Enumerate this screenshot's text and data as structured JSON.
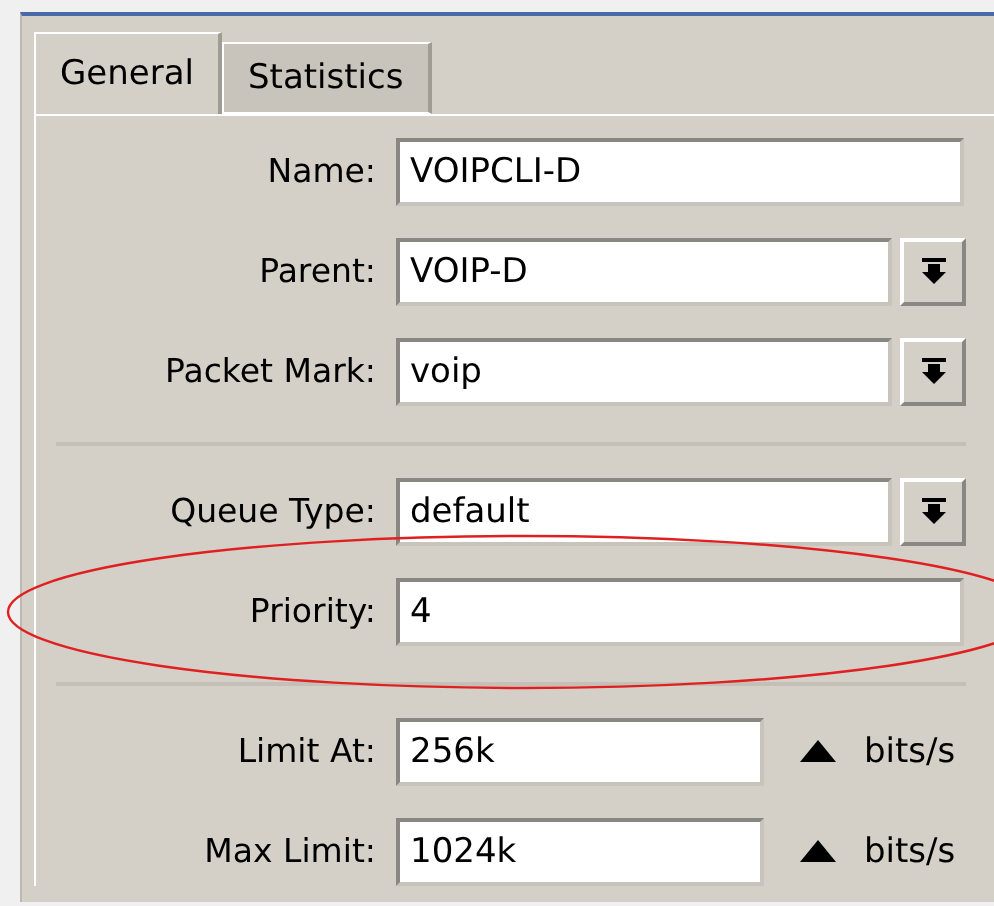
{
  "tabs": [
    {
      "label": "General",
      "selected": true
    },
    {
      "label": "Statistics",
      "selected": false
    }
  ],
  "sections": [
    {
      "rows": [
        {
          "kind": "text",
          "label": "Name:",
          "value": "VOIPCLI-D",
          "highlighted": false
        },
        {
          "kind": "select",
          "label": "Parent:",
          "value": "VOIP-D",
          "highlighted": false
        },
        {
          "kind": "select",
          "label": "Packet Mark:",
          "value": "voip",
          "highlighted": false
        }
      ]
    },
    {
      "rows": [
        {
          "kind": "select",
          "label": "Queue Type:",
          "value": "default",
          "highlighted": false
        },
        {
          "kind": "text",
          "label": "Priority:",
          "value": "4",
          "highlighted": true
        }
      ]
    },
    {
      "rows": [
        {
          "kind": "rate",
          "label": "Limit At:",
          "value": "256k",
          "unit": "bits/s",
          "highlighted": false
        },
        {
          "kind": "rate",
          "label": "Max Limit:",
          "value": "1024k",
          "unit": "bits/s",
          "highlighted": false
        }
      ]
    }
  ]
}
